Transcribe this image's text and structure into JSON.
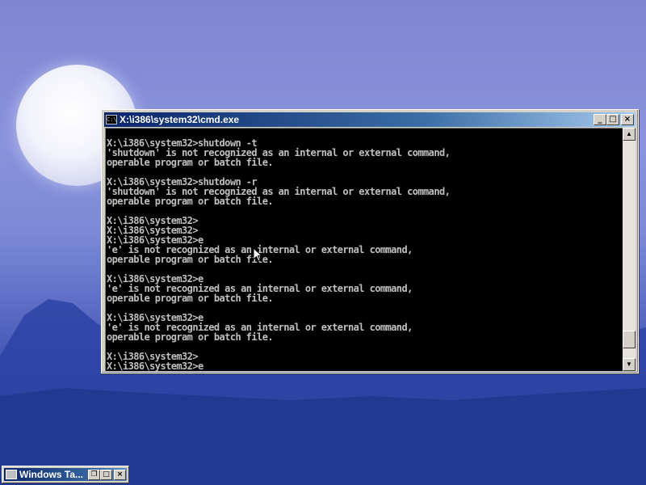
{
  "desktop": {
    "accent_sky": "#7f86d2",
    "accent_ground": "#24368e"
  },
  "console_window": {
    "title": "X:\\i386\\system32\\cmd.exe",
    "icon_label": "C:\\",
    "buttons": {
      "minimize": "_",
      "maximize": "□",
      "close": "×"
    },
    "text_color": "#c0c0c0",
    "background_color": "#000000",
    "lines": [
      "X:\\i386\\system32>shutdown -t",
      "'shutdown' is not recognized as an internal or external command,",
      "operable program or batch file.",
      "",
      "X:\\i386\\system32>shutdown -r",
      "'shutdown' is not recognized as an internal or external command,",
      "operable program or batch file.",
      "",
      "X:\\i386\\system32>",
      "X:\\i386\\system32>",
      "X:\\i386\\system32>e",
      "'e' is not recognized as an internal or external command,",
      "operable program or batch file.",
      "",
      "X:\\i386\\system32>e",
      "'e' is not recognized as an internal or external command,",
      "operable program or batch file.",
      "",
      "X:\\i386\\system32>e",
      "'e' is not recognized as an internal or external command,",
      "operable program or batch file.",
      "",
      "X:\\i386\\system32>",
      "X:\\i386\\system32>e"
    ],
    "scrollbar": {
      "up": "▲",
      "down": "▼",
      "position": 0.95
    }
  },
  "minimized_window": {
    "title": "Windows Ta...",
    "buttons": {
      "restore": "❐",
      "maximize": "□",
      "close": "×"
    }
  }
}
